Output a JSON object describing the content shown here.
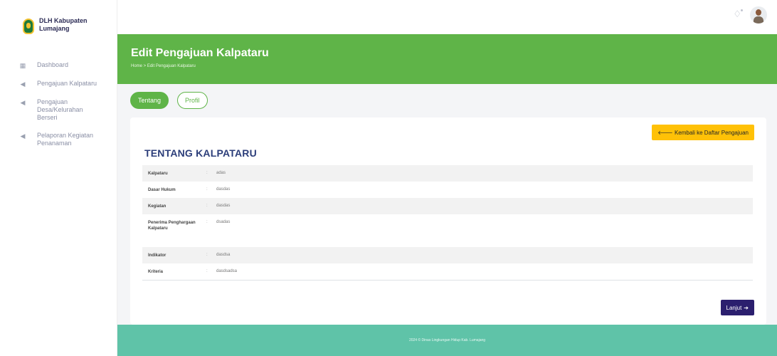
{
  "brand": {
    "line1": "DLH Kabupaten",
    "line2": "Lumajang"
  },
  "sidebar": {
    "items": [
      {
        "icon": "dashboard-icon",
        "label": "Dashboard"
      },
      {
        "icon": "send-icon",
        "label": "Pengajuan Kalpataru"
      },
      {
        "icon": "send-icon",
        "label": "Pengajuan Desa/Kelurahan Berseri"
      },
      {
        "icon": "send-icon",
        "label": "Pelaporan Kegiatan Penanaman"
      }
    ]
  },
  "topbar": {
    "bell_icon": "bell-icon",
    "avatar_icon": "avatar-icon"
  },
  "header": {
    "title": "Edit Pengajuan Kalpataru",
    "breadcrumb": "Home > Edit Pengajuan Kalpataru"
  },
  "tabs": [
    {
      "label": "Tentang",
      "active": true
    },
    {
      "label": "Profil",
      "active": false
    }
  ],
  "card": {
    "back_button": "Kembali ke Daftar Pengajuan",
    "section_title": "TENTANG KALPATARU",
    "rows": [
      {
        "key": "Kalpataru",
        "value": "adas"
      },
      {
        "key": "Dasar Hukum",
        "value": "dasdas"
      },
      {
        "key": "Kegiatan",
        "value": "dasdas"
      },
      {
        "key": "Penerima Penghargaan Kalpataru",
        "value": "dsadas"
      },
      {
        "key": "Indikator",
        "value": "dasdsa"
      },
      {
        "key": "Kriteria",
        "value": "dasdsadsa"
      }
    ],
    "colon": ":",
    "next_button": "Lanjut"
  },
  "footer": {
    "text": "2024 © Dinas Lingkungan Hidup Kab. Lumajang"
  },
  "colors": {
    "green": "#5fb448",
    "teal": "#5fc3a8",
    "yellow": "#ffc107",
    "navy": "#2b1f6e"
  }
}
